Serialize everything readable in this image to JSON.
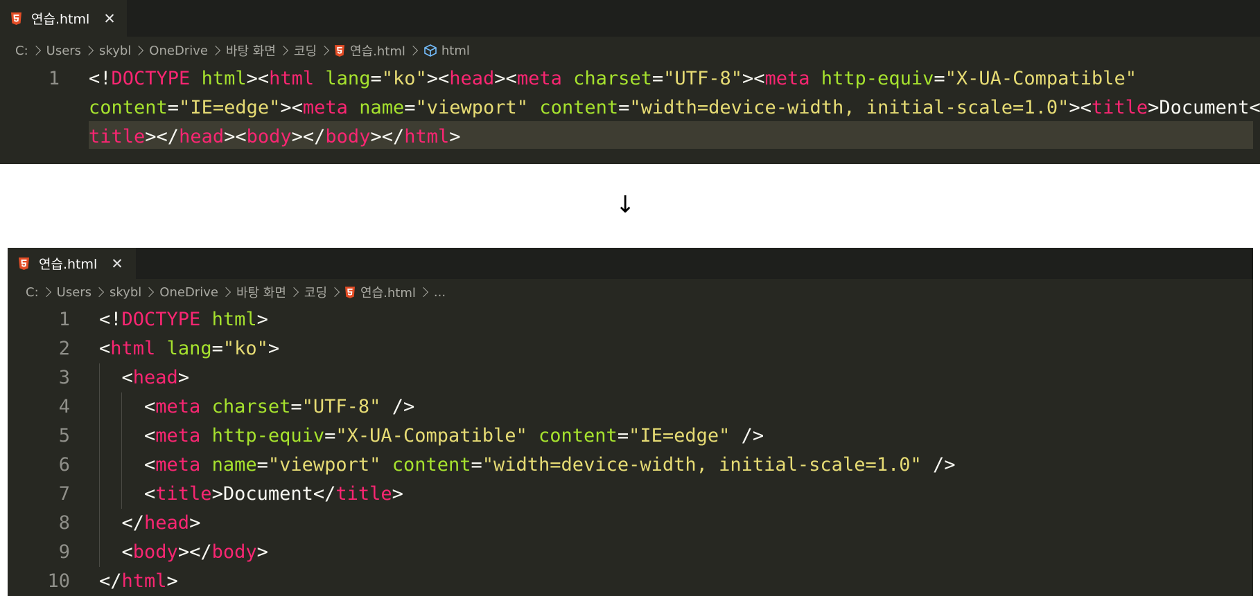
{
  "top_editor": {
    "tab": {
      "filename": "연습.html",
      "close_glyph": "✕"
    },
    "breadcrumb": [
      "C:",
      "Users",
      "skybl",
      "OneDrive",
      "바탕 화면",
      "코딩",
      "연습.html",
      "html"
    ],
    "lines": [
      {
        "number": "1",
        "segments": [
          {
            "t": "p",
            "v": "<!"
          },
          {
            "t": "tag",
            "v": "DOCTYPE"
          },
          {
            "t": "p",
            "v": " "
          },
          {
            "t": "attr",
            "v": "html"
          },
          {
            "t": "p",
            "v": "><"
          },
          {
            "t": "tag",
            "v": "html"
          },
          {
            "t": "p",
            "v": " "
          },
          {
            "t": "attr",
            "v": "lang"
          },
          {
            "t": "p",
            "v": "="
          },
          {
            "t": "str",
            "v": "\"ko\""
          },
          {
            "t": "p",
            "v": "><"
          },
          {
            "t": "tag",
            "v": "head"
          },
          {
            "t": "p",
            "v": "><"
          },
          {
            "t": "tag",
            "v": "meta"
          },
          {
            "t": "p",
            "v": " "
          },
          {
            "t": "attr",
            "v": "charset"
          },
          {
            "t": "p",
            "v": "="
          },
          {
            "t": "str",
            "v": "\"UTF-8\""
          },
          {
            "t": "p",
            "v": "><"
          },
          {
            "t": "tag",
            "v": "meta"
          },
          {
            "t": "p",
            "v": " "
          },
          {
            "t": "attr",
            "v": "http-equiv"
          },
          {
            "t": "p",
            "v": "="
          },
          {
            "t": "str",
            "v": "\"X-UA-Compatible\""
          }
        ]
      },
      {
        "number": "",
        "segments": [
          {
            "t": "attr",
            "v": "content"
          },
          {
            "t": "p",
            "v": "="
          },
          {
            "t": "str",
            "v": "\"IE=edge\""
          },
          {
            "t": "p",
            "v": "><"
          },
          {
            "t": "tag",
            "v": "meta"
          },
          {
            "t": "p",
            "v": " "
          },
          {
            "t": "attr",
            "v": "name"
          },
          {
            "t": "p",
            "v": "="
          },
          {
            "t": "str",
            "v": "\"viewport\""
          },
          {
            "t": "p",
            "v": " "
          },
          {
            "t": "attr",
            "v": "content"
          },
          {
            "t": "p",
            "v": "="
          },
          {
            "t": "str",
            "v": "\"width=device-width, initial-scale=1.0\""
          },
          {
            "t": "p",
            "v": "><"
          },
          {
            "t": "tag",
            "v": "title"
          },
          {
            "t": "p",
            "v": ">"
          },
          {
            "t": "txt",
            "v": "Document"
          },
          {
            "t": "p",
            "v": "</"
          }
        ]
      },
      {
        "number": "",
        "segments": [
          {
            "t": "tag",
            "v": "title"
          },
          {
            "t": "p",
            "v": "></"
          },
          {
            "t": "tag",
            "v": "head"
          },
          {
            "t": "p",
            "v": "><"
          },
          {
            "t": "tag",
            "v": "body"
          },
          {
            "t": "p",
            "v": "></"
          },
          {
            "t": "tag",
            "v": "body"
          },
          {
            "t": "p",
            "v": "></"
          },
          {
            "t": "tag",
            "v": "html"
          },
          {
            "t": "p",
            "v": ">"
          }
        ]
      }
    ]
  },
  "arrow": "↓",
  "bottom_editor": {
    "tab": {
      "filename": "연습.html",
      "close_glyph": "✕"
    },
    "breadcrumb": [
      "C:",
      "Users",
      "skybl",
      "OneDrive",
      "바탕 화면",
      "코딩",
      "연습.html",
      "..."
    ],
    "lines": [
      {
        "number": "1",
        "segments": [
          {
            "t": "p",
            "v": "<!"
          },
          {
            "t": "tag",
            "v": "DOCTYPE"
          },
          {
            "t": "p",
            "v": " "
          },
          {
            "t": "attr",
            "v": "html"
          },
          {
            "t": "p",
            "v": ">"
          }
        ]
      },
      {
        "number": "2",
        "segments": [
          {
            "t": "p",
            "v": "<"
          },
          {
            "t": "tag",
            "v": "html"
          },
          {
            "t": "p",
            "v": " "
          },
          {
            "t": "attr",
            "v": "lang"
          },
          {
            "t": "p",
            "v": "="
          },
          {
            "t": "str",
            "v": "\"ko\""
          },
          {
            "t": "p",
            "v": ">"
          }
        ]
      },
      {
        "number": "3",
        "segments": [
          {
            "t": "p",
            "v": "  <"
          },
          {
            "t": "tag",
            "v": "head"
          },
          {
            "t": "p",
            "v": ">"
          }
        ]
      },
      {
        "number": "4",
        "segments": [
          {
            "t": "p",
            "v": "    <"
          },
          {
            "t": "tag",
            "v": "meta"
          },
          {
            "t": "p",
            "v": " "
          },
          {
            "t": "attr",
            "v": "charset"
          },
          {
            "t": "p",
            "v": "="
          },
          {
            "t": "str",
            "v": "\"UTF-8\""
          },
          {
            "t": "p",
            "v": " />"
          }
        ]
      },
      {
        "number": "5",
        "segments": [
          {
            "t": "p",
            "v": "    <"
          },
          {
            "t": "tag",
            "v": "meta"
          },
          {
            "t": "p",
            "v": " "
          },
          {
            "t": "attr",
            "v": "http-equiv"
          },
          {
            "t": "p",
            "v": "="
          },
          {
            "t": "str",
            "v": "\"X-UA-Compatible\""
          },
          {
            "t": "p",
            "v": " "
          },
          {
            "t": "attr",
            "v": "content"
          },
          {
            "t": "p",
            "v": "="
          },
          {
            "t": "str",
            "v": "\"IE=edge\""
          },
          {
            "t": "p",
            "v": " />"
          }
        ]
      },
      {
        "number": "6",
        "segments": [
          {
            "t": "p",
            "v": "    <"
          },
          {
            "t": "tag",
            "v": "meta"
          },
          {
            "t": "p",
            "v": " "
          },
          {
            "t": "attr",
            "v": "name"
          },
          {
            "t": "p",
            "v": "="
          },
          {
            "t": "str",
            "v": "\"viewport\""
          },
          {
            "t": "p",
            "v": " "
          },
          {
            "t": "attr",
            "v": "content"
          },
          {
            "t": "p",
            "v": "="
          },
          {
            "t": "str",
            "v": "\"width=device-width, initial-scale=1.0\""
          },
          {
            "t": "p",
            "v": " />"
          }
        ]
      },
      {
        "number": "7",
        "segments": [
          {
            "t": "p",
            "v": "    <"
          },
          {
            "t": "tag",
            "v": "title"
          },
          {
            "t": "p",
            "v": ">"
          },
          {
            "t": "txt",
            "v": "Document"
          },
          {
            "t": "p",
            "v": "</"
          },
          {
            "t": "tag",
            "v": "title"
          },
          {
            "t": "p",
            "v": ">"
          }
        ]
      },
      {
        "number": "8",
        "segments": [
          {
            "t": "p",
            "v": "  </"
          },
          {
            "t": "tag",
            "v": "head"
          },
          {
            "t": "p",
            "v": ">"
          }
        ]
      },
      {
        "number": "9",
        "segments": [
          {
            "t": "p",
            "v": "  <"
          },
          {
            "t": "tag",
            "v": "body"
          },
          {
            "t": "p",
            "v": "></"
          },
          {
            "t": "tag",
            "v": "body"
          },
          {
            "t": "p",
            "v": ">"
          }
        ]
      },
      {
        "number": "10",
        "segments": [
          {
            "t": "p",
            "v": "</"
          },
          {
            "t": "tag",
            "v": "html"
          },
          {
            "t": "p",
            "v": ">"
          }
        ]
      }
    ]
  },
  "colors": {
    "editor_bg": "#272822",
    "tab_bar_bg": "#1e1f1c",
    "tag": "#f92672",
    "attribute": "#a6e22e",
    "string": "#e6db74",
    "plain": "#f8f8f2",
    "line_number": "#90908a",
    "html5_orange": "#e44d26",
    "cube_blue": "#75beff"
  },
  "icons": {
    "file": "html5-icon",
    "breadcrumb_symbol": "cube-icon",
    "separator": "chevron-right-icon",
    "close": "close-icon"
  }
}
